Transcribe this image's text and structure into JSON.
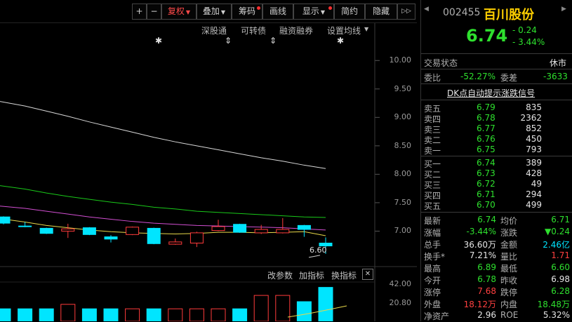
{
  "toolbar": {
    "plus": "+",
    "minus": "−",
    "fuquan": "复权",
    "diejia": "叠加",
    "chouma": "筹码",
    "huaxian": "画线",
    "xianshi": "显示",
    "jianyue": "简约",
    "yincang": "隐藏",
    "expand": "▷▷"
  },
  "row2": {
    "shengutong": "深股通",
    "kezhuanzhai": "可转债",
    "rongzi": "融资融券",
    "shezhi": "设置均线"
  },
  "chart_data": {
    "type": "candlestick",
    "ylim": [
      6.5,
      10.25
    ],
    "yticks": [
      "10.00",
      "9.50",
      "9.00",
      "8.50",
      "8.00",
      "7.50",
      "7.00"
    ],
    "low_annotation": "6.60",
    "candles": [
      {
        "o": 7.25,
        "c": 7.14,
        "h": 7.26,
        "l": 7.12
      },
      {
        "o": 7.09,
        "c": 7.08,
        "h": 7.16,
        "l": 7.07
      },
      {
        "o": 7.05,
        "c": 6.96,
        "h": 7.06,
        "l": 6.95
      },
      {
        "o": 7.0,
        "c": 7.04,
        "h": 7.13,
        "l": 6.88
      },
      {
        "o": 7.06,
        "c": 6.94,
        "h": 7.07,
        "l": 6.93
      },
      {
        "o": 6.9,
        "c": 6.86,
        "h": 6.93,
        "l": 6.8
      },
      {
        "o": 6.94,
        "c": 7.07,
        "h": 7.08,
        "l": 6.93
      },
      {
        "o": 7.05,
        "c": 6.78,
        "h": 7.06,
        "l": 6.77
      },
      {
        "o": 6.77,
        "c": 6.81,
        "h": 6.87,
        "l": 6.76
      },
      {
        "o": 6.79,
        "c": 6.97,
        "h": 6.99,
        "l": 6.72
      },
      {
        "o": 7.01,
        "c": 7.08,
        "h": 7.2,
        "l": 7.0
      },
      {
        "o": 7.12,
        "c": 6.98,
        "h": 7.13,
        "l": 6.97
      },
      {
        "o": 6.97,
        "c": 7.03,
        "h": 7.11,
        "l": 6.95
      },
      {
        "o": 6.97,
        "c": 7.03,
        "h": 7.23,
        "l": 6.96
      },
      {
        "o": 7.1,
        "c": 7.03,
        "h": 7.11,
        "l": 6.9
      },
      {
        "o": 6.79,
        "c": 6.74,
        "h": 6.89,
        "l": 6.6
      }
    ],
    "ma_white": [
      9.28,
      9.2,
      9.11,
      9.02,
      8.92,
      8.83,
      8.74,
      8.65,
      8.57,
      8.5,
      8.43,
      8.36,
      8.29,
      8.23,
      8.16,
      8.1
    ],
    "ma_green": [
      7.8,
      7.74,
      7.67,
      7.61,
      7.56,
      7.51,
      7.47,
      7.42,
      7.39,
      7.35,
      7.33,
      7.31,
      7.29,
      7.27,
      7.25,
      7.24
    ],
    "ma_magenta": [
      7.44,
      7.4,
      7.35,
      7.3,
      7.25,
      7.21,
      7.17,
      7.14,
      7.12,
      7.1,
      7.09,
      7.08,
      7.07,
      7.06,
      7.04,
      7.02
    ],
    "ma_yellow": [
      7.22,
      7.16,
      7.1,
      7.06,
      7.02,
      6.99,
      6.97,
      6.96,
      6.95,
      6.96,
      6.98,
      6.98,
      6.97,
      6.98,
      6.99,
      6.92
    ],
    "volume": {
      "yticks": [
        "42.00",
        "20.80"
      ],
      "ylim": [
        0,
        44
      ],
      "bars": [
        {
          "v": 14,
          "up": false
        },
        {
          "v": 14,
          "up": false
        },
        {
          "v": 14,
          "up": false
        },
        {
          "v": 19,
          "up": true
        },
        {
          "v": 14,
          "up": false
        },
        {
          "v": 14,
          "up": false
        },
        {
          "v": 14,
          "up": true
        },
        {
          "v": 14,
          "up": false
        },
        {
          "v": 14,
          "up": true
        },
        {
          "v": 14,
          "up": true
        },
        {
          "v": 14,
          "up": true
        },
        {
          "v": 14,
          "up": false
        },
        {
          "v": 29,
          "up": true
        },
        {
          "v": 29,
          "up": true
        },
        {
          "v": 22,
          "up": false
        },
        {
          "v": 38,
          "up": false
        }
      ]
    }
  },
  "sub": {
    "gaicanshu": "改参数",
    "jiazhibiao": "加指标",
    "huanzhibiao": "换指标",
    "close": "✕"
  },
  "quote": {
    "code": "002455",
    "name": "百川股份",
    "price": "6.74",
    "change": "- 0.24",
    "pct": "- 3.44%",
    "status_label": "交易状态",
    "status": "休市",
    "weibi_label": "委比",
    "weibi": "-52.27%",
    "weicha_label": "委差",
    "weicha": "-3633",
    "dk_link": "DK点自动提示涨跌信号",
    "asks": [
      {
        "label": "卖五",
        "price": "6.79",
        "vol": "835"
      },
      {
        "label": "卖四",
        "price": "6.78",
        "vol": "2362"
      },
      {
        "label": "卖三",
        "price": "6.77",
        "vol": "852"
      },
      {
        "label": "卖二",
        "price": "6.76",
        "vol": "450"
      },
      {
        "label": "卖一",
        "price": "6.75",
        "vol": "793"
      }
    ],
    "bids": [
      {
        "label": "买一",
        "price": "6.74",
        "vol": "389"
      },
      {
        "label": "买二",
        "price": "6.73",
        "vol": "428"
      },
      {
        "label": "买三",
        "price": "6.72",
        "vol": "49"
      },
      {
        "label": "买四",
        "price": "6.71",
        "vol": "294"
      },
      {
        "label": "买五",
        "price": "6.70",
        "vol": "499"
      }
    ],
    "stats": [
      {
        "l1": "最新",
        "v1": "6.74",
        "c1": "g",
        "l2": "均价",
        "v2": "6.71",
        "c2": "g"
      },
      {
        "l1": "涨幅",
        "v1": "-3.44%",
        "c1": "g",
        "l2": "涨跌",
        "v2": "▼0.24",
        "c2": "g"
      },
      {
        "l1": "总手",
        "v1": "36.60万",
        "c1": "w",
        "l2": "金额",
        "v2": "2.46亿",
        "c2": "cyan"
      },
      {
        "l1": "换手*",
        "v1": "7.21%",
        "c1": "w",
        "l2": "量比",
        "v2": "1.71",
        "c2": "red"
      },
      {
        "l1": "最高",
        "v1": "6.89",
        "c1": "g",
        "l2": "最低",
        "v2": "6.60",
        "c2": "g"
      },
      {
        "l1": "今开",
        "v1": "6.78",
        "c1": "g",
        "l2": "昨收",
        "v2": "6.98",
        "c2": "w"
      },
      {
        "l1": "涨停",
        "v1": "7.68",
        "c1": "red",
        "l2": "跌停",
        "v2": "6.28",
        "c2": "g"
      },
      {
        "l1": "外盘",
        "v1": "18.12万",
        "c1": "red",
        "l2": "内盘",
        "v2": "18.48万",
        "c2": "g"
      },
      {
        "l1": "净资产",
        "v1": "2.96",
        "c1": "w",
        "l2": "ROE",
        "v2": "5.32%",
        "c2": "w"
      }
    ]
  }
}
